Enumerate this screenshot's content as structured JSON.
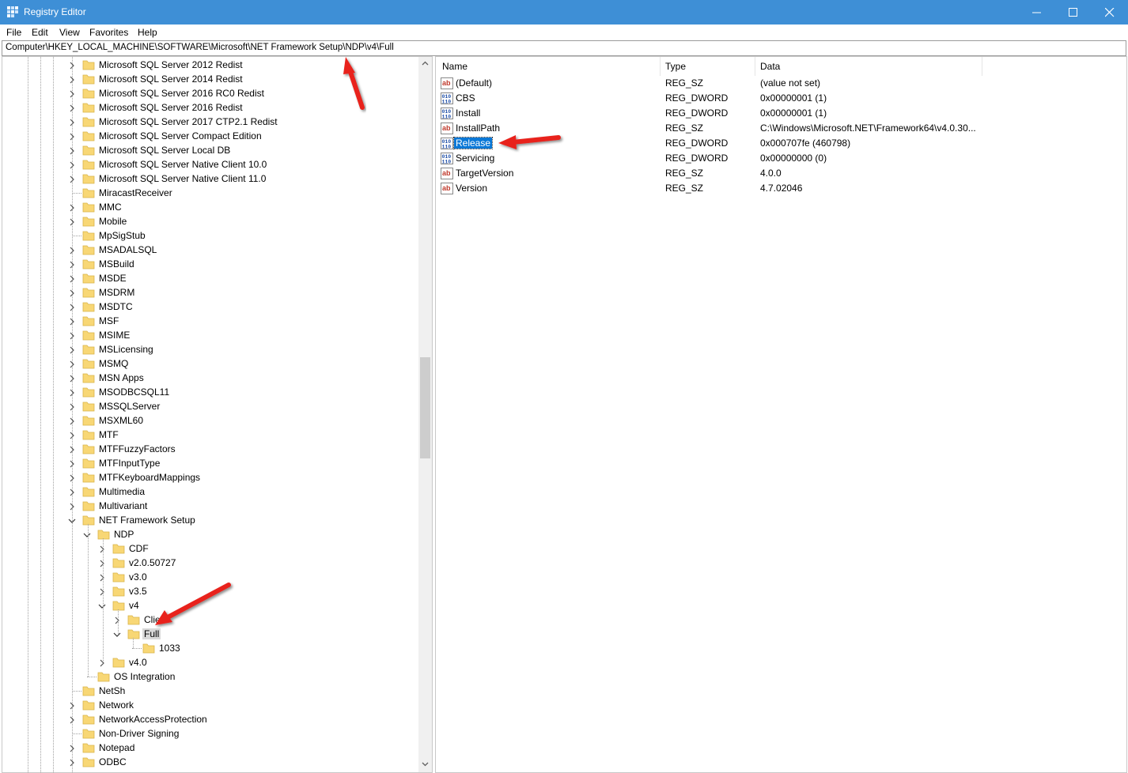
{
  "window": {
    "title": "Registry Editor"
  },
  "menu": [
    "File",
    "Edit",
    "View",
    "Favorites",
    "Help"
  ],
  "address": "Computer\\HKEY_LOCAL_MACHINE\\SOFTWARE\\Microsoft\\NET Framework Setup\\NDP\\v4\\Full",
  "tree": [
    {
      "label": "Microsoft SQL Server 2012 Redist",
      "level": 0,
      "expander": "collapsed"
    },
    {
      "label": "Microsoft SQL Server 2014 Redist",
      "level": 0,
      "expander": "collapsed"
    },
    {
      "label": "Microsoft SQL Server 2016 RC0 Redist",
      "level": 0,
      "expander": "collapsed"
    },
    {
      "label": "Microsoft SQL Server 2016 Redist",
      "level": 0,
      "expander": "collapsed"
    },
    {
      "label": "Microsoft SQL Server 2017 CTP2.1 Redist",
      "level": 0,
      "expander": "collapsed"
    },
    {
      "label": "Microsoft SQL Server Compact Edition",
      "level": 0,
      "expander": "collapsed"
    },
    {
      "label": "Microsoft SQL Server Local DB",
      "level": 0,
      "expander": "collapsed"
    },
    {
      "label": "Microsoft SQL Server Native Client 10.0",
      "level": 0,
      "expander": "collapsed"
    },
    {
      "label": "Microsoft SQL Server Native Client 11.0",
      "level": 0,
      "expander": "collapsed"
    },
    {
      "label": "MiracastReceiver",
      "level": 0,
      "expander": "none"
    },
    {
      "label": "MMC",
      "level": 0,
      "expander": "collapsed"
    },
    {
      "label": "Mobile",
      "level": 0,
      "expander": "collapsed"
    },
    {
      "label": "MpSigStub",
      "level": 0,
      "expander": "none"
    },
    {
      "label": "MSADALSQL",
      "level": 0,
      "expander": "collapsed"
    },
    {
      "label": "MSBuild",
      "level": 0,
      "expander": "collapsed"
    },
    {
      "label": "MSDE",
      "level": 0,
      "expander": "collapsed"
    },
    {
      "label": "MSDRM",
      "level": 0,
      "expander": "collapsed"
    },
    {
      "label": "MSDTC",
      "level": 0,
      "expander": "collapsed"
    },
    {
      "label": "MSF",
      "level": 0,
      "expander": "collapsed"
    },
    {
      "label": "MSIME",
      "level": 0,
      "expander": "collapsed"
    },
    {
      "label": "MSLicensing",
      "level": 0,
      "expander": "collapsed"
    },
    {
      "label": "MSMQ",
      "level": 0,
      "expander": "collapsed"
    },
    {
      "label": "MSN Apps",
      "level": 0,
      "expander": "collapsed"
    },
    {
      "label": "MSODBCSQL11",
      "level": 0,
      "expander": "collapsed"
    },
    {
      "label": "MSSQLServer",
      "level": 0,
      "expander": "collapsed"
    },
    {
      "label": "MSXML60",
      "level": 0,
      "expander": "collapsed"
    },
    {
      "label": "MTF",
      "level": 0,
      "expander": "collapsed"
    },
    {
      "label": "MTFFuzzyFactors",
      "level": 0,
      "expander": "collapsed"
    },
    {
      "label": "MTFInputType",
      "level": 0,
      "expander": "collapsed"
    },
    {
      "label": "MTFKeyboardMappings",
      "level": 0,
      "expander": "collapsed"
    },
    {
      "label": "Multimedia",
      "level": 0,
      "expander": "collapsed"
    },
    {
      "label": "Multivariant",
      "level": 0,
      "expander": "collapsed"
    },
    {
      "label": "NET Framework Setup",
      "level": 0,
      "expander": "expanded"
    },
    {
      "label": "NDP",
      "level": 1,
      "expander": "expanded"
    },
    {
      "label": "CDF",
      "level": 2,
      "expander": "collapsed"
    },
    {
      "label": "v2.0.50727",
      "level": 2,
      "expander": "collapsed"
    },
    {
      "label": "v3.0",
      "level": 2,
      "expander": "collapsed"
    },
    {
      "label": "v3.5",
      "level": 2,
      "expander": "collapsed"
    },
    {
      "label": "v4",
      "level": 2,
      "expander": "expanded"
    },
    {
      "label": "Clie",
      "level": 3,
      "expander": "collapsed"
    },
    {
      "label": "Full",
      "level": 3,
      "expander": "expanded",
      "selected": true
    },
    {
      "label": "1033",
      "level": 4,
      "expander": "none"
    },
    {
      "label": "v4.0",
      "level": 2,
      "expander": "collapsed"
    },
    {
      "label": "OS Integration",
      "level": 1,
      "expander": "none"
    },
    {
      "label": "NetSh",
      "level": 0,
      "expander": "none"
    },
    {
      "label": "Network",
      "level": 0,
      "expander": "collapsed"
    },
    {
      "label": "NetworkAccessProtection",
      "level": 0,
      "expander": "collapsed"
    },
    {
      "label": "Non-Driver Signing",
      "level": 0,
      "expander": "none"
    },
    {
      "label": "Notepad",
      "level": 0,
      "expander": "collapsed"
    },
    {
      "label": "ODBC",
      "level": 0,
      "expander": "collapsed"
    }
  ],
  "values": {
    "columns": [
      "Name",
      "Type",
      "Data"
    ],
    "rows": [
      {
        "name": "(Default)",
        "type": "REG_SZ",
        "data": "(value not set)",
        "icon": "string-value-icon"
      },
      {
        "name": "CBS",
        "type": "REG_DWORD",
        "data": "0x00000001 (1)",
        "icon": "binary-value-icon"
      },
      {
        "name": "Install",
        "type": "REG_DWORD",
        "data": "0x00000001 (1)",
        "icon": "binary-value-icon"
      },
      {
        "name": "InstallPath",
        "type": "REG_SZ",
        "data": "C:\\Windows\\Microsoft.NET\\Framework64\\v4.0.30...",
        "icon": "string-value-icon"
      },
      {
        "name": "Release",
        "type": "REG_DWORD",
        "data": "0x000707fe (460798)",
        "icon": "binary-value-icon",
        "selected": true
      },
      {
        "name": "Servicing",
        "type": "REG_DWORD",
        "data": "0x00000000 (0)",
        "icon": "binary-value-icon"
      },
      {
        "name": "TargetVersion",
        "type": "REG_SZ",
        "data": "4.0.0",
        "icon": "string-value-icon"
      },
      {
        "name": "Version",
        "type": "REG_SZ",
        "data": "4.7.02046",
        "icon": "string-value-icon"
      }
    ]
  },
  "colors": {
    "titlebar": "#3e8fd6",
    "selection": "#0a78d7",
    "annotation_arrow": "#e8231c",
    "folder": "#f8d775"
  }
}
